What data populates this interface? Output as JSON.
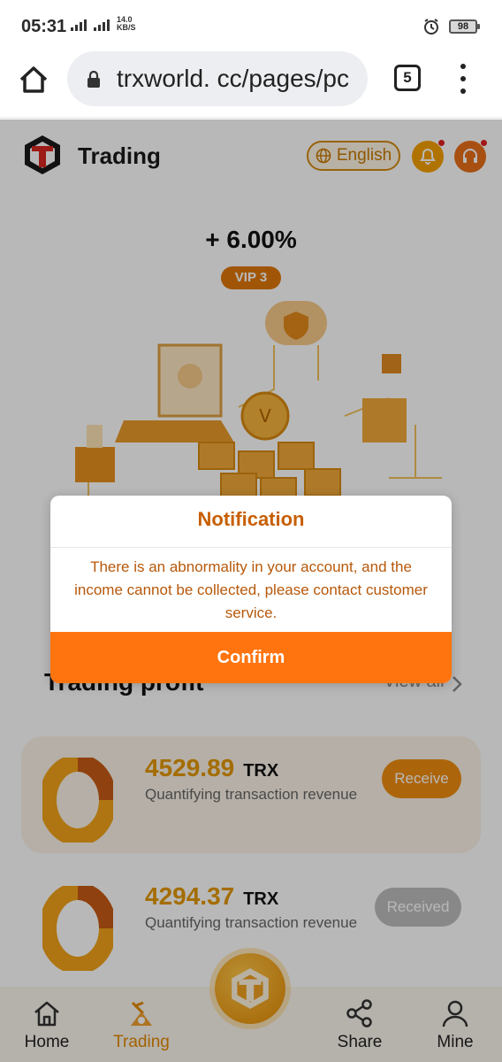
{
  "status_bar": {
    "time": "05:31",
    "net_type": "4G",
    "speed_value": "14.0",
    "speed_unit": "KB/S",
    "battery": "98"
  },
  "browser": {
    "url": "trxworld. cc/pages/pc",
    "tab_count": "5"
  },
  "header": {
    "title": "Trading",
    "language": "English"
  },
  "hero": {
    "rate": "+ 6.00%",
    "vip": "VIP 3"
  },
  "profit_section": {
    "title": "Trading profit",
    "view_all": "View all",
    "items": [
      {
        "amount": "4529.89",
        "unit": "TRX",
        "description": "Quantifying transaction revenue",
        "action": "Receive"
      },
      {
        "amount": "4294.37",
        "unit": "TRX",
        "description": "Quantifying transaction revenue",
        "action": "Received"
      }
    ]
  },
  "bottom_nav": {
    "items": [
      {
        "label": "Home",
        "icon": "home-icon"
      },
      {
        "label": "Trading",
        "icon": "mining-icon"
      },
      {
        "label": "Share",
        "icon": "share-icon"
      },
      {
        "label": "Mine",
        "icon": "user-icon"
      }
    ]
  },
  "modal": {
    "title": "Notification",
    "message": "There is an abnormality in your account, and the income cannot be collected, please contact customer service.",
    "confirm": "Confirm"
  },
  "colors": {
    "accent": "#ff740f",
    "gold": "#e39700",
    "modal_text": "#b7580a"
  }
}
